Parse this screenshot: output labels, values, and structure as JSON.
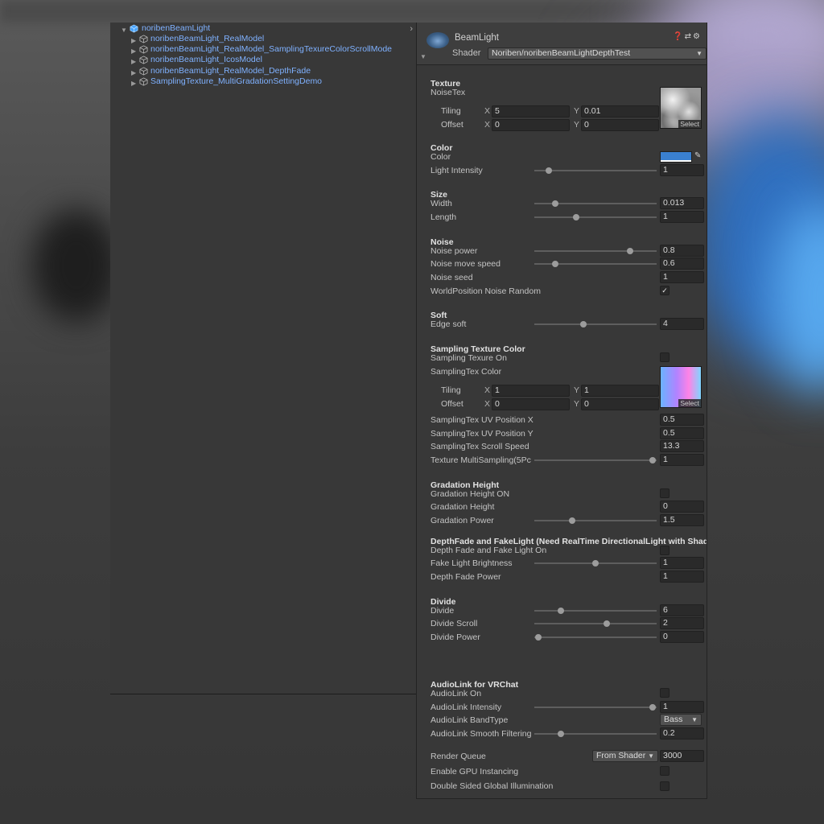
{
  "hierarchy": {
    "root": "noribenBeamLight",
    "children": [
      "noribenBeamLight_RealModel",
      "noribenBeamLight_RealModel_SamplingTexureColorScrollMode",
      "noribenBeamLight_IcosModel",
      "noribenBeamLight_RealModel_DepthFade",
      "SamplingTexture_MultiGradationSettingDemo"
    ]
  },
  "inspector": {
    "material_name": "BeamLight",
    "shader_label": "Shader",
    "shader_value": "Noriben/noribenBeamLightDepthTest",
    "texture": {
      "section": "Texture",
      "prop": "NoiseTex",
      "tiling_label": "Tiling",
      "offset_label": "Offset",
      "tiling_x": "5",
      "tiling_y": "0.01",
      "offset_x": "0",
      "offset_y": "0",
      "select": "Select"
    },
    "color": {
      "section": "Color",
      "prop": "Color",
      "intensity_label": "Light Intensity",
      "intensity_value": "1",
      "intensity_slider": 0.12,
      "swatch": "#3a80d0"
    },
    "size": {
      "section": "Size",
      "width_label": "Width",
      "width_value": "0.013",
      "width_slider": 0.17,
      "length_label": "Length",
      "length_value": "1",
      "length_slider": 0.34
    },
    "noise": {
      "section": "Noise",
      "power_label": "Noise power",
      "power_value": "0.8",
      "power_slider": 0.78,
      "speed_label": "Noise move speed",
      "speed_value": "0.6",
      "speed_slider": 0.17,
      "seed_label": "Noise seed",
      "seed_value": "1",
      "random_label": "WorldPosition Noise Random",
      "random_checked": true
    },
    "soft": {
      "section": "Soft",
      "edge_label": "Edge soft",
      "edge_value": "4",
      "edge_slider": 0.4
    },
    "sampling": {
      "section": "Sampling Texture Color",
      "on_label": "Sampling Texure On",
      "color_label": "SamplingTex Color",
      "tiling_label": "Tiling",
      "offset_label": "Offset",
      "tiling_x": "1",
      "tiling_y": "1",
      "offset_x": "0",
      "offset_y": "0",
      "select": "Select",
      "uvx_label": "SamplingTex UV Position X",
      "uvx_value": "0.5",
      "uvy_label": "SamplingTex UV Position Y",
      "uvy_value": "0.5",
      "scroll_label": "SamplingTex Scroll Speed",
      "scroll_value": "13.3",
      "multi_label": "Texture MultiSampling(5Pc",
      "multi_value": "1",
      "multi_slider": 0.97
    },
    "gradation": {
      "section": "Gradation Height",
      "on_label": "Gradation Height ON",
      "height_label": "Gradation Height",
      "height_value": "0",
      "power_label": "Gradation Power",
      "power_value": "1.5",
      "power_slider": 0.31
    },
    "depthfade": {
      "section": "DepthFade and FakeLight (Need RealTime DirectionalLight with Shad",
      "on_label": "Depth Fade and Fake Light On",
      "bright_label": "Fake Light Brightness",
      "bright_value": "1",
      "bright_slider": 0.5,
      "power_label": "Depth Fade Power",
      "power_value": "1"
    },
    "divide": {
      "section": "Divide",
      "divide_label": "Divide",
      "divide_value": "6",
      "divide_slider": 0.22,
      "scroll_label": "Divide Scroll",
      "scroll_value": "2",
      "scroll_slider": 0.59,
      "power_label": "Divide Power",
      "power_value": "0",
      "power_slider": 0.03
    },
    "audiolink": {
      "section": "AudioLink for VRChat",
      "on_label": "AudioLink On",
      "intensity_label": "AudioLink Intensity",
      "intensity_value": "1",
      "intensity_slider": 0.97,
      "band_label": "AudioLink BandType",
      "band_value": "Bass",
      "smooth_label": "AudioLink Smooth Filtering",
      "smooth_value": "0.2",
      "smooth_slider": 0.22
    },
    "footer": {
      "queue_label": "Render Queue",
      "queue_mode": "From Shader",
      "queue_value": "3000",
      "gpu_label": "Enable GPU Instancing",
      "gi_label": "Double Sided Global Illumination"
    }
  }
}
